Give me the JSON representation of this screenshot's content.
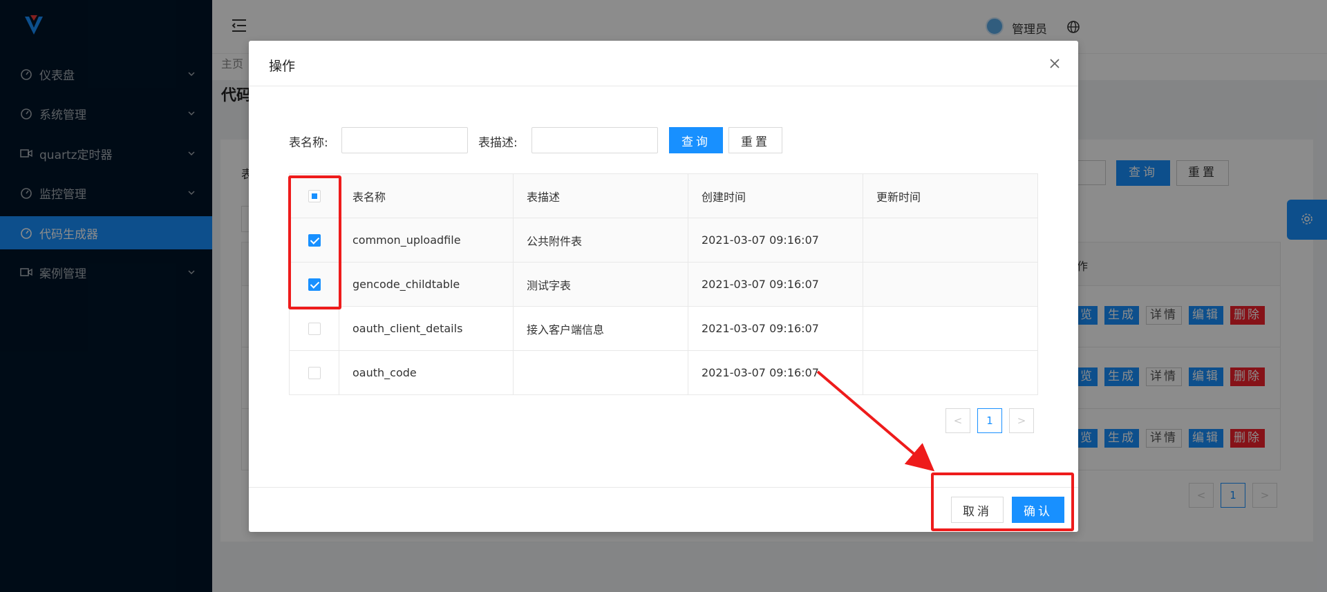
{
  "sidebar": {
    "items": [
      {
        "label": "仪表盘",
        "icon": "dashboard-icon"
      },
      {
        "label": "系统管理",
        "icon": "dashboard-icon"
      },
      {
        "label": "quartz定时器",
        "icon": "video-icon"
      },
      {
        "label": "监控管理",
        "icon": "dashboard-icon"
      },
      {
        "label": "代码生成器",
        "icon": "dashboard-icon",
        "active": true
      },
      {
        "label": "案例管理",
        "icon": "video-icon"
      }
    ]
  },
  "header": {
    "user_name": "管理员"
  },
  "background_page": {
    "breadcrumb_home": "主页",
    "title_partial": "代码",
    "query_label_partial": "表",
    "query_button": "查询",
    "reset_button": "重置",
    "op_column_partial": "作",
    "row_ops": [
      "览",
      "生成",
      "详情",
      "编辑",
      "删除"
    ],
    "pager_current": "1"
  },
  "modal": {
    "title": "操作",
    "query": {
      "table_name_label": "表名称:",
      "table_name_value": "",
      "table_desc_label": "表描述:",
      "table_desc_value": "",
      "query_button": "查询",
      "reset_button": "重置"
    },
    "table": {
      "headers": [
        "表名称",
        "表描述",
        "创建时间",
        "更新时间"
      ],
      "rows": [
        {
          "name": "common_uploadfile",
          "desc": "公共附件表",
          "created": "2021-03-07 09:16:07",
          "updated": "",
          "checked": true
        },
        {
          "name": "gencode_childtable",
          "desc": "测试字表",
          "created": "2021-03-07 09:16:07",
          "updated": "",
          "checked": true
        },
        {
          "name": "oauth_client_details",
          "desc": "接入客户端信息",
          "created": "2021-03-07 09:16:07",
          "updated": "",
          "checked": false
        },
        {
          "name": "oauth_code",
          "desc": "",
          "created": "2021-03-07 09:16:07",
          "updated": "",
          "checked": false
        }
      ]
    },
    "pager": {
      "current": "1",
      "prev": "<",
      "next": ">"
    },
    "footer": {
      "cancel_button": "取消",
      "confirm_button": "确认"
    }
  },
  "colors": {
    "primary": "#1890ff",
    "sidebar_bg": "#001529",
    "danger": "#f5222d",
    "annotation": "#ee1b1b"
  }
}
